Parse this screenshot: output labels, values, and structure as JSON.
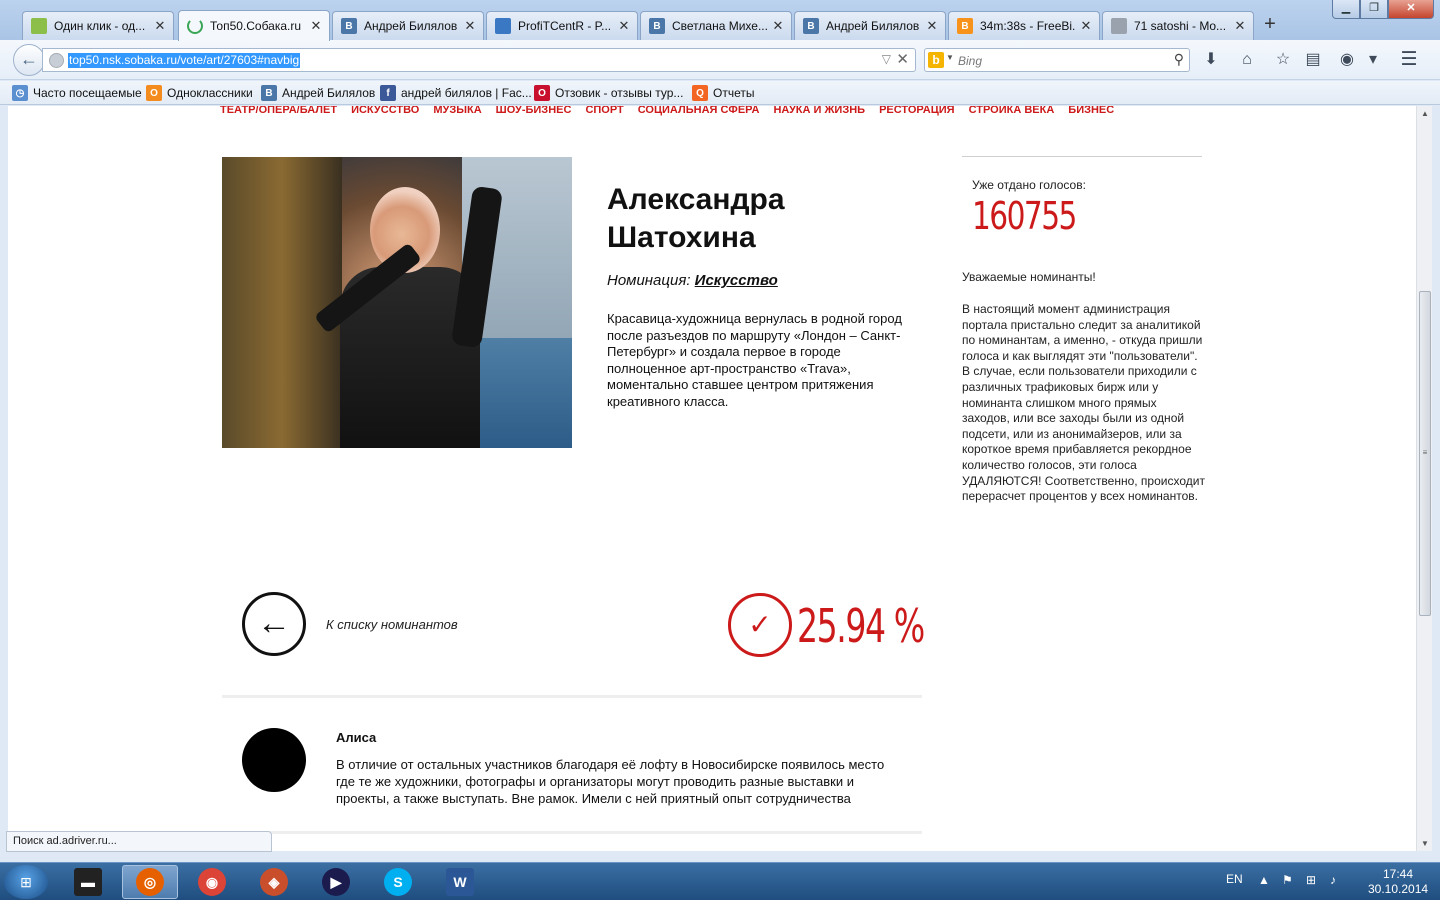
{
  "window": {
    "tabs": [
      {
        "title": "Один клик - од...",
        "favicon": "odnoklik-icon",
        "color": "#8bbf4a",
        "glyph": "",
        "active": false
      },
      {
        "title": "Топ50.Собака.ru",
        "favicon": "loading-icon",
        "color": "#3aa655",
        "glyph": "",
        "active": true
      },
      {
        "title": "Андрей Билялов",
        "favicon": "vk-icon",
        "color": "#4a76a8",
        "glyph": "В",
        "active": false
      },
      {
        "title": "ProfiTCentR - P...",
        "favicon": "profit-icon",
        "color": "#3b78c4",
        "glyph": "",
        "active": false
      },
      {
        "title": "Светлана Михе...",
        "favicon": "vk-icon",
        "color": "#4a76a8",
        "glyph": "В",
        "active": false
      },
      {
        "title": "Андрей Билялов",
        "favicon": "vk-icon",
        "color": "#4a76a8",
        "glyph": "В",
        "active": false
      },
      {
        "title": "34m:38s - FreeBi...",
        "favicon": "bitcoin-icon",
        "color": "#f7931a",
        "glyph": "B",
        "active": false
      },
      {
        "title": "71 satoshi - Mo...",
        "favicon": "moon-icon",
        "color": "#9aa3ad",
        "glyph": "",
        "active": false
      }
    ],
    "new_tab": "+",
    "controls": {
      "minimize": "▁",
      "maximize": "❐",
      "close": "✕"
    }
  },
  "navbar": {
    "back_glyph": "←",
    "url": "top50.nsk.sobaka.ru/vote/art/27603#navbig",
    "url_dropdown": "▽",
    "url_clear": "✕",
    "search_engine": "b",
    "search_placeholder": "Bing",
    "search_glyph": "⚲",
    "icons": [
      {
        "name": "download-icon",
        "glyph": "⬇"
      },
      {
        "name": "home-icon",
        "glyph": "⌂"
      },
      {
        "name": "bookmark-star-icon",
        "glyph": "☆"
      },
      {
        "name": "reading-list-icon",
        "glyph": "▤"
      },
      {
        "name": "addon-icon",
        "glyph": "◉"
      },
      {
        "name": "addon-dropdown-icon",
        "glyph": "▾"
      },
      {
        "name": "menu-icon",
        "glyph": "☰"
      }
    ]
  },
  "bookmarks": [
    {
      "label": "Часто посещаемые",
      "favicon": "most-visited-icon",
      "color": "#5a8fd0",
      "glyph": "◷"
    },
    {
      "label": "Одноклассники",
      "favicon": "odnoklassniki-icon",
      "color": "#f48b1e",
      "glyph": "О"
    },
    {
      "label": "Андрей Билялов",
      "favicon": "vk-icon",
      "color": "#4a76a8",
      "glyph": "В"
    },
    {
      "label": "андрей билялов | Fac...",
      "favicon": "facebook-icon",
      "color": "#3b5998",
      "glyph": "f"
    },
    {
      "label": "Отзовик - отзывы тур...",
      "favicon": "otzovik-icon",
      "color": "#c8102e",
      "glyph": "O"
    },
    {
      "label": "Отчеты",
      "favicon": "reports-icon",
      "color": "#f26522",
      "glyph": "Q"
    }
  ],
  "page": {
    "categories": [
      "ТЕАТР/ОПЕРА/БАЛЕТ",
      "ИСКУССТВО",
      "МУЗЫКА",
      "ШОУ-БИЗНЕС",
      "СПОРТ",
      "СОЦИАЛЬНАЯ СФЕРА",
      "НАУКА И ЖИЗНЬ",
      "РЕСТОРАЦИЯ",
      "СТРОЙКА ВЕКА",
      "БИЗНЕС"
    ],
    "nominee_name": "Александра Шатохина",
    "nomination_label": "Номинация: ",
    "nomination_value": "Искусство",
    "description": "Красавица-художница вернулась в родной город после разъездов по маршруту «Лондон – Санкт-Петербург» и создала первое в городе  полноценное арт-пространство «Trava», моментально ставшее центром притяжения креативного класса.",
    "votes_label": "Уже отдано голосов:",
    "votes_count": "160755",
    "notice_title": "Уважаемые номинанты!",
    "notice_text": "В настоящий момент администрация портала пристально следит за аналитикой по номинантам, а именно, - откуда пришли голоса и как выглядят эти \"пользователи\". В случае, если пользователи приходили с различных трафиковых бирж или у номинанта слишком много прямых заходов, или все заходы были из одной подсети, или из анонимайзеров, или за короткое время прибавляется рекордное количество голосов, эти голоса УДАЛЯЮТСЯ! Соответственно, происходит перерасчет процентов у всех номинантов.",
    "back_glyph": "←",
    "back_label": "К списку номинантов",
    "vote_glyph": "✓",
    "percent": "25.94 %",
    "comment": {
      "author": "Алиса",
      "text": "В отличие от остальных участников благодаря её лофту в Новосибирске появилось место где те же художники, фотографы и организаторы могут проводить разные выставки и проекты, а также выступать. Вне рамок. Имели с ней приятный опыт сотрудничества"
    }
  },
  "status_text": "Поиск ad.adriver.ru...",
  "taskbar": {
    "start_glyph": "⊞",
    "apps": [
      {
        "name": "taskbar-unknown-app",
        "color": "#222222",
        "glyph": "▬",
        "active": false
      },
      {
        "name": "taskbar-firefox",
        "color": "#e66000",
        "glyph": "◎",
        "active": true
      },
      {
        "name": "taskbar-chrome",
        "color": "#db4437",
        "glyph": "◉",
        "active": false
      },
      {
        "name": "taskbar-eye-app",
        "color": "#c94f2c",
        "glyph": "◈",
        "active": false
      },
      {
        "name": "taskbar-media-player",
        "color": "#1b1b4d",
        "glyph": "▶",
        "active": false
      },
      {
        "name": "taskbar-skype",
        "color": "#00aff0",
        "glyph": "S",
        "active": false
      },
      {
        "name": "taskbar-word",
        "color": "#2b5797",
        "glyph": "W",
        "active": false
      }
    ],
    "tray": {
      "lang": "EN",
      "icons": [
        {
          "name": "tray-expand-icon",
          "glyph": "▲"
        },
        {
          "name": "tray-flag-icon",
          "glyph": "⚑"
        },
        {
          "name": "tray-network-icon",
          "glyph": "⊞"
        },
        {
          "name": "tray-volume-icon",
          "glyph": "♪"
        }
      ],
      "time": "17:44",
      "date": "30.10.2014"
    }
  }
}
